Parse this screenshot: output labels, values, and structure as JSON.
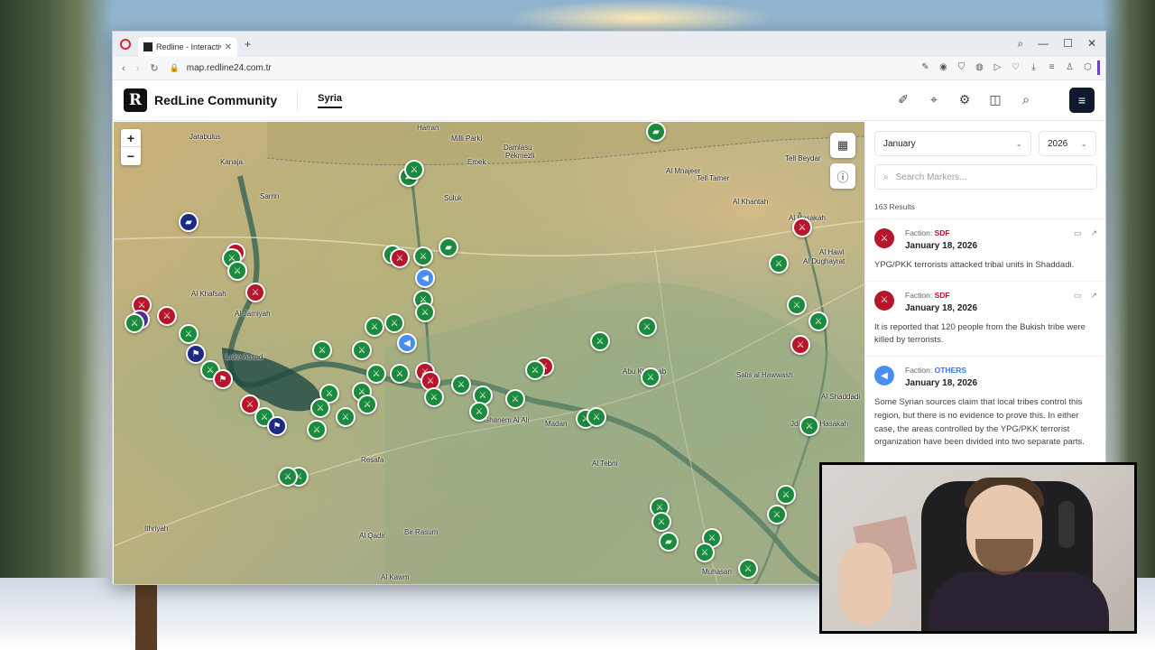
{
  "browser": {
    "tab_title": "Redline - Interactive Strat",
    "url": "map.redline24.com.tr"
  },
  "app": {
    "brand_letter": "R",
    "brand_name": "RedLine Community",
    "nav_tab": "Syria",
    "header_icons": [
      "draw-icon",
      "location-pin-icon",
      "settings-icon",
      "camera-icon",
      "search-icon"
    ]
  },
  "map": {
    "zoom_in": "+",
    "zoom_out": "−",
    "places": [
      "Jarabulus",
      "Kanaja",
      "Sarrin",
      "Harran",
      "Damlasu",
      "Pekmezli",
      "Emek",
      "Al Mnajeer",
      "Al Khantah",
      "Al Hasakah",
      "Al Hawl",
      "Abu Khashab",
      "Al Khafsah",
      "Al-Jamiyah",
      "Lake Assad",
      "Ghanem Al Ali",
      "Madan",
      "Al Tebni",
      "Salis al Hawwash",
      "Resafa",
      "Ithriyah",
      "Bir Rasum",
      "Al Qadir",
      "Al Kawm",
      "Muhasan",
      "Tell Tamer",
      "Al Dughayrat",
      "Suluk",
      "Milli Parki",
      "Tell Beydar",
      "Al Shaddadi",
      "Jdidat Al Hasakah"
    ]
  },
  "panel": {
    "month": "January",
    "year": "2026",
    "search_placeholder": "Search Markers...",
    "result_count": "163 Results",
    "entries": [
      {
        "faction_label": "Faction:",
        "faction": "SDF",
        "date": "January 18, 2026",
        "text": "YPG/PKK terrorists attacked tribal units in Shaddadi."
      },
      {
        "faction_label": "Faction:",
        "faction": "SDF",
        "date": "January 18, 2026",
        "text": "It is reported that 120 people from the Bukish tribe were killed by terrorists."
      },
      {
        "faction_label": "Faction:",
        "faction": "OTHERS",
        "date": "January 18, 2026",
        "text": "Some Syrian sources claim that local tribes control this region, but there is no evidence to prove this. In either case, the areas controlled by the YPG/PKK terrorist organization have been divided into two separate parts."
      }
    ]
  },
  "colors": {
    "sdf": "#b5162b",
    "others": "#3a78d8",
    "government": "#1a8a3c",
    "navy": "#1c2a86"
  }
}
